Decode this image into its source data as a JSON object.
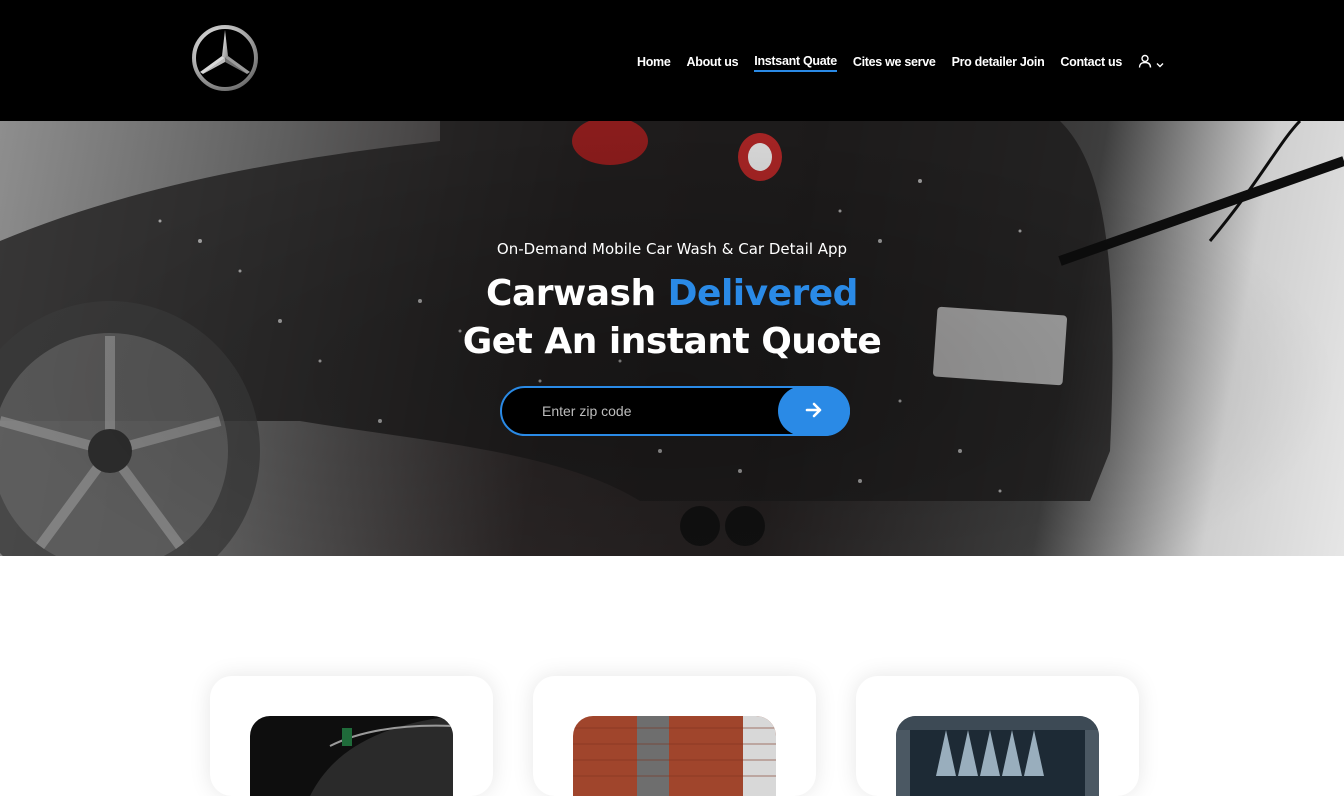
{
  "header": {
    "logo": {
      "icon": "mercedes-star-icon"
    },
    "nav": [
      {
        "label": "Home",
        "active": false
      },
      {
        "label": "About us",
        "active": false
      },
      {
        "label": "Instsant Quate",
        "active": true
      },
      {
        "label": "Cites we serve",
        "active": false
      },
      {
        "label": "Pro detailer Join",
        "active": false
      },
      {
        "label": "Contact us",
        "active": false
      }
    ],
    "user_menu": {
      "icon": "user-icon",
      "dropdown_icon": "chevron-down-icon"
    }
  },
  "hero": {
    "tagline": "On-Demand Mobile Car Wash & Car Detail App",
    "headline_line1_part1": "Carwash ",
    "headline_line1_accent": "Delivered",
    "headline_line2": "Get An instant Quote",
    "zip_input": {
      "placeholder": "Enter zip code",
      "value": ""
    },
    "submit_icon": "arrow-right-icon"
  },
  "cards": [
    {
      "image": "dark-car-image"
    },
    {
      "image": "brick-building-image"
    },
    {
      "image": "car-wash-brushes-image"
    }
  ],
  "colors": {
    "accent": "#2a8ae6",
    "header_bg": "#000000",
    "page_bg": "#ffffff"
  }
}
